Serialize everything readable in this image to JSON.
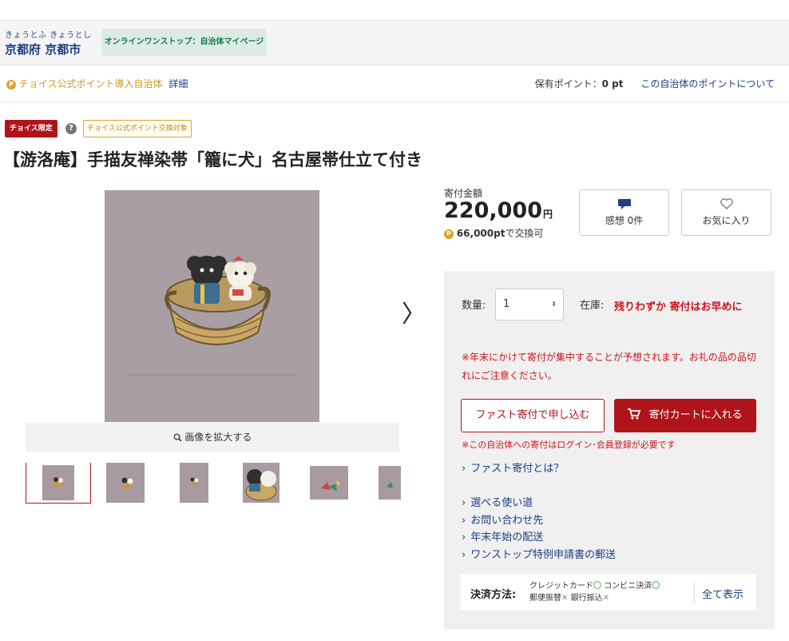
{
  "municipality": {
    "kana": "きょうとふ きょうとし",
    "name": "京都府 京都市",
    "onestop_label": "オンラインワンストップ：自治体マイページ"
  },
  "points_bar": {
    "coin": "P",
    "official_label": "チョイス公式ポイント導入自治体",
    "detail_link": "詳細",
    "holding_label": "保有ポイント：",
    "holding_value": "0 pt",
    "about_link": "この自治体のポイントについて"
  },
  "tags": {
    "limited": "チョイス限定",
    "help": "?",
    "exchange": "チョイス公式ポイント交換対象"
  },
  "product": {
    "title": "【游洛庵】手描友禅染帯「籠に犬」名古屋帯仕立て付き",
    "zoom_label": "画像を拡大する",
    "next_arrow": "〉",
    "thumbnails": [
      "thumb-1",
      "thumb-2",
      "thumb-3",
      "thumb-4",
      "thumb-5",
      "thumb-6"
    ]
  },
  "donation": {
    "amount_label": "寄付金額",
    "amount": "220,000",
    "yen": "円",
    "points": "66,000pt",
    "points_suffix": "で交換可",
    "review_label": "感想 0件",
    "favorite_label": "お気に入り"
  },
  "order_panel": {
    "qty_label": "数量:",
    "qty_value": "1",
    "stock_label": "在庫:",
    "stock_value": "残りわずか 寄付はお早めに",
    "notice": "※年末にかけて寄付が集中することが予想されます。お礼の品の品切れにご注意ください。",
    "fast_button": "ファスト寄付で申し込む",
    "cart_button": "寄付カートに入れる",
    "login_note": "※この自治体への寄付はログイン･会員登録が必要です",
    "fast_about_link": "ファスト寄付とは？",
    "links": [
      "選べる使い道",
      "お問い合わせ先",
      "年末年始の配送",
      "ワンストップ特例申請書の郵送"
    ],
    "payment": {
      "label": "決済方法:",
      "credit": "クレジットカード",
      "convenience": "コンビニ決済",
      "postal": "郵便振替",
      "bank": "銀行振込",
      "ok_mark": "〇",
      "ng_mark": "✕",
      "show_all": "全て表示"
    }
  },
  "colors": {
    "accent_red": "#b0141b",
    "link_blue": "#1f3e83",
    "gold": "#d9a52a",
    "obi_mauve": "#a79aa1"
  }
}
